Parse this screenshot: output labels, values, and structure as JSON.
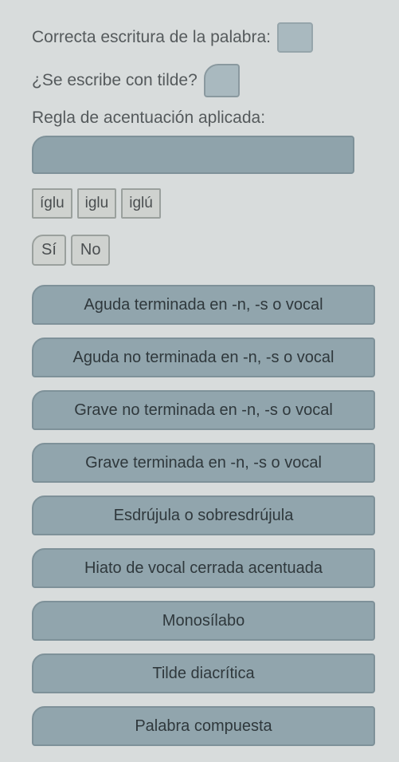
{
  "labels": {
    "correct_spelling": "Correcta escritura de la palabra:",
    "has_tilde": "¿Se escribe con tilde?",
    "rule_applied": "Regla de acentuación aplicada:"
  },
  "word_options": [
    "íglu",
    "iglu",
    "iglú"
  ],
  "yesno": {
    "yes": "Sí",
    "no": "No"
  },
  "rules": [
    "Aguda terminada en -n, -s o vocal",
    "Aguda no terminada en -n, -s o vocal",
    "Grave no terminada en -n, -s o vocal",
    "Grave terminada en -n, -s o vocal",
    "Esdrújula o sobresdrújula",
    "Hiato de vocal cerrada acentuada",
    "Monosílabo",
    "Tilde diacrítica",
    "Palabra compuesta"
  ]
}
